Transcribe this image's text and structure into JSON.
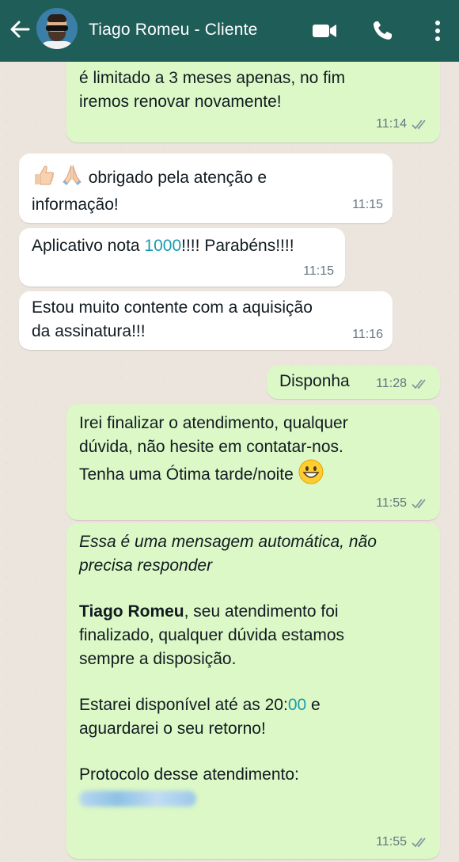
{
  "header": {
    "contact_name": "Tiago Romeu - Cliente",
    "back_icon": "arrow-left-icon",
    "video_icon": "video-camera-icon",
    "call_icon": "phone-icon",
    "more_icon": "more-vertical-icon",
    "bar_color": "#1f5d58"
  },
  "messages": [
    {
      "direction": "outgoing",
      "lines": [
        "é limitado a 3 meses apenas, no fim",
        "iremos renovar novamente!"
      ],
      "time": "11:14",
      "read": true
    },
    {
      "direction": "incoming",
      "emoji": [
        "thumbs-up",
        "praying-hands"
      ],
      "lines": [
        "obrigado pela atenção e",
        "informação!"
      ],
      "time": "11:15"
    },
    {
      "direction": "incoming",
      "text_before": "Aplicativo nota ",
      "highlight": "1000",
      "text_after": "!!!! Parabéns!!!!",
      "time": "11:15"
    },
    {
      "direction": "incoming",
      "lines": [
        "Estou muito contente com a aquisição",
        "da assinatura!!!"
      ],
      "time": "11:16"
    },
    {
      "direction": "outgoing",
      "lines": [
        "Disponha"
      ],
      "time": "11:28",
      "read": true
    },
    {
      "direction": "outgoing",
      "lines": [
        "Irei finalizar o atendimento, qualquer",
        "dúvida,  não hesite em contatar-nos.",
        "Tenha uma Ótima tarde/noite"
      ],
      "emoji": "grinning-face",
      "time": "11:55",
      "read": true
    },
    {
      "direction": "outgoing",
      "italic_lines": [
        "Essa é uma mensagem automática, não",
        "precisa responder"
      ],
      "bold_name": "Tiago Romeu",
      "para1_rest": ", seu atendimento foi",
      "para1_lines": [
        "finalizado, qualquer dúvida estamos",
        "sempre a disposição."
      ],
      "para2_before": "Estarei disponível até as 20:",
      "para2_highlight": "00",
      "para2_after": " e",
      "para2_line2": "aguardarei o seu retorno!",
      "protocol_label": "Protocolo desse atendimento:",
      "time": "11:55",
      "read": true
    }
  ],
  "colors": {
    "outgoing_bubble": "#dcf8c6",
    "incoming_bubble": "#ffffff",
    "highlight_text": "#1a9bb0"
  }
}
